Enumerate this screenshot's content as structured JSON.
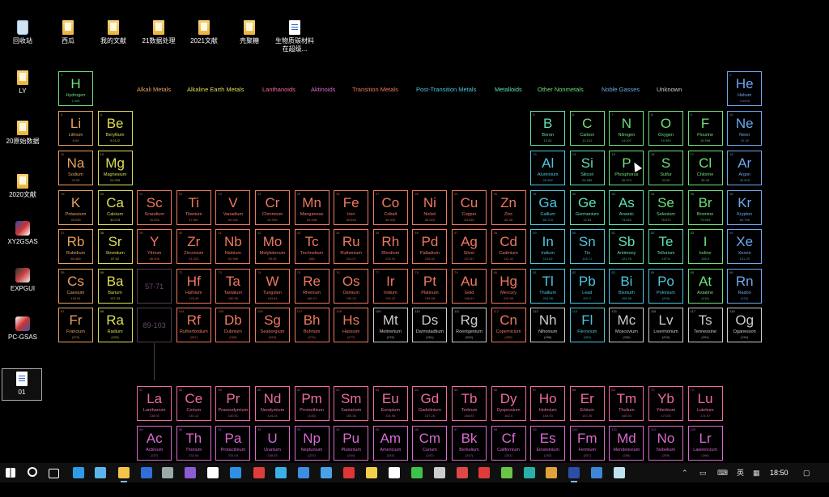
{
  "colors": {
    "alkali": "#e8a060",
    "alkaline": "#dedd5a",
    "transition": "#f07860",
    "post": "#4cc7e0",
    "metalloid": "#5ee0b0",
    "nonmetal": "#6ee07a",
    "noble": "#6ea8f0",
    "unknown": "#cccccc",
    "lanthanide": "#ee6aa6",
    "actinide": "#d86ad0"
  },
  "desktop_icons": [
    {
      "label": "回收站",
      "kind": "bin"
    },
    {
      "label": "LY",
      "kind": "folder"
    },
    {
      "label": "20原始数据",
      "kind": "folder"
    },
    {
      "label": "2020文献",
      "kind": "folder"
    },
    {
      "label": "XY2GSAS",
      "kind": "gsas"
    },
    {
      "label": "EXPGUI",
      "kind": "expgui"
    },
    {
      "label": "PC-GSAS",
      "kind": "pcgsas"
    },
    {
      "label": "01",
      "kind": "doc"
    },
    {
      "label": "西瓜",
      "kind": "folder"
    },
    {
      "label": "我的文献",
      "kind": "folder"
    },
    {
      "label": "21数据处理",
      "kind": "folder"
    },
    {
      "label": "2021文献",
      "kind": "folder"
    },
    {
      "label": "壳聚糖",
      "kind": "folder"
    },
    {
      "label": "生物质碳材料在超级...",
      "kind": "doc"
    }
  ],
  "legend": [
    {
      "label": "Alkali Metals",
      "cat": "alkali"
    },
    {
      "label": "Alkaline Earth Metals",
      "cat": "alkaline"
    },
    {
      "label": "Lanthanoids",
      "cat": "lanthanide"
    },
    {
      "label": "Aktinoids",
      "cat": "actinide"
    },
    {
      "label": "Transition Metals",
      "cat": "transition"
    },
    {
      "label": "Post-Transition Metals",
      "cat": "post"
    },
    {
      "label": "Metalloids",
      "cat": "metalloid"
    },
    {
      "label": "Other Nonmetals",
      "cat": "nonmetal"
    },
    {
      "label": "Noble Gasses",
      "cat": "noble"
    },
    {
      "label": "Unknown",
      "cat": "unknown"
    }
  ],
  "placeholders": [
    "57-71",
    "89-103"
  ],
  "elements": [
    {
      "n": 1,
      "s": "H",
      "name": "Hydrogen",
      "m": "1.008",
      "c": "nonmetal"
    },
    {
      "n": 2,
      "s": "He",
      "name": "Helium",
      "m": "4.0026",
      "c": "noble"
    },
    {
      "n": 3,
      "s": "Li",
      "name": "Lithium",
      "m": "6.94",
      "c": "alkali"
    },
    {
      "n": 4,
      "s": "Be",
      "name": "Beryllium",
      "m": "9.0122",
      "c": "alkaline"
    },
    {
      "n": 5,
      "s": "B",
      "name": "Boron",
      "m": "10.81",
      "c": "metalloid"
    },
    {
      "n": 6,
      "s": "C",
      "name": "Carbon",
      "m": "12.011",
      "c": "nonmetal"
    },
    {
      "n": 7,
      "s": "N",
      "name": "Nitrogen",
      "m": "14.007",
      "c": "nonmetal"
    },
    {
      "n": 8,
      "s": "O",
      "name": "Oxygen",
      "m": "15.999",
      "c": "nonmetal"
    },
    {
      "n": 9,
      "s": "F",
      "name": "Flourine",
      "m": "18.998",
      "c": "nonmetal"
    },
    {
      "n": 10,
      "s": "Ne",
      "name": "Neon",
      "m": "20.18",
      "c": "noble"
    },
    {
      "n": 11,
      "s": "Na",
      "name": "Sodium",
      "m": "22.99",
      "c": "alkali"
    },
    {
      "n": 12,
      "s": "Mg",
      "name": "Magnesium",
      "m": "24.305",
      "c": "alkaline"
    },
    {
      "n": 13,
      "s": "Al",
      "name": "Aluminium",
      "m": "26.982",
      "c": "post"
    },
    {
      "n": 14,
      "s": "Si",
      "name": "Silicon",
      "m": "28.085",
      "c": "metalloid"
    },
    {
      "n": 15,
      "s": "P",
      "name": "Phosphorus",
      "m": "30.974",
      "c": "nonmetal"
    },
    {
      "n": 16,
      "s": "S",
      "name": "Sulfur",
      "m": "32.06",
      "c": "nonmetal"
    },
    {
      "n": 17,
      "s": "Cl",
      "name": "Chlorine",
      "m": "35.45",
      "c": "nonmetal"
    },
    {
      "n": 18,
      "s": "Ar",
      "name": "Argon",
      "m": "39.948",
      "c": "noble"
    },
    {
      "n": 19,
      "s": "K",
      "name": "Potassium",
      "m": "39.098",
      "c": "alkali"
    },
    {
      "n": 20,
      "s": "Ca",
      "name": "Calcium",
      "m": "40.078",
      "c": "alkaline"
    },
    {
      "n": 21,
      "s": "Sc",
      "name": "Scandium",
      "m": "44.956",
      "c": "transition"
    },
    {
      "n": 22,
      "s": "Ti",
      "name": "Titanium",
      "m": "47.867",
      "c": "transition"
    },
    {
      "n": 23,
      "s": "V",
      "name": "Vanadium",
      "m": "50.942",
      "c": "transition"
    },
    {
      "n": 24,
      "s": "Cr",
      "name": "Chromium",
      "m": "51.996",
      "c": "transition"
    },
    {
      "n": 25,
      "s": "Mn",
      "name": "Manganese",
      "m": "54.938",
      "c": "transition"
    },
    {
      "n": 26,
      "s": "Fe",
      "name": "Iron",
      "m": "55.845",
      "c": "transition"
    },
    {
      "n": 27,
      "s": "Co",
      "name": "Cobalt",
      "m": "58.933",
      "c": "transition"
    },
    {
      "n": 28,
      "s": "Ni",
      "name": "Nickel",
      "m": "58.693",
      "c": "transition"
    },
    {
      "n": 29,
      "s": "Cu",
      "name": "Copper",
      "m": "63.546",
      "c": "transition"
    },
    {
      "n": 30,
      "s": "Zn",
      "name": "Zinc",
      "m": "65.38",
      "c": "transition"
    },
    {
      "n": 31,
      "s": "Ga",
      "name": "Gallium",
      "m": "69.723",
      "c": "post"
    },
    {
      "n": 32,
      "s": "Ge",
      "name": "Germanium",
      "m": "72.63",
      "c": "metalloid"
    },
    {
      "n": 33,
      "s": "As",
      "name": "Arsenic",
      "m": "74.922",
      "c": "metalloid"
    },
    {
      "n": 34,
      "s": "Se",
      "name": "Selenium",
      "m": "78.971",
      "c": "nonmetal"
    },
    {
      "n": 35,
      "s": "Br",
      "name": "Bromine",
      "m": "79.904",
      "c": "nonmetal"
    },
    {
      "n": 36,
      "s": "Kr",
      "name": "Krypton",
      "m": "83.798",
      "c": "noble"
    },
    {
      "n": 37,
      "s": "Rb",
      "name": "Rubidium",
      "m": "85.468",
      "c": "alkali"
    },
    {
      "n": 38,
      "s": "Sr",
      "name": "Strontium",
      "m": "87.62",
      "c": "alkaline"
    },
    {
      "n": 39,
      "s": "Y",
      "name": "Yttrium",
      "m": "88.906",
      "c": "transition"
    },
    {
      "n": 40,
      "s": "Zr",
      "name": "Zirconium",
      "m": "91.224",
      "c": "transition"
    },
    {
      "n": 41,
      "s": "Nb",
      "name": "Niobium",
      "m": "92.906",
      "c": "transition"
    },
    {
      "n": 42,
      "s": "Mo",
      "name": "Molybdenum",
      "m": "95.95",
      "c": "transition"
    },
    {
      "n": 43,
      "s": "Tc",
      "name": "Technetium",
      "m": "(98)",
      "c": "transition"
    },
    {
      "n": 44,
      "s": "Ru",
      "name": "Ruthenium",
      "m": "101.07",
      "c": "transition"
    },
    {
      "n": 45,
      "s": "Rh",
      "name": "Rhodium",
      "m": "102.91",
      "c": "transition"
    },
    {
      "n": 46,
      "s": "Pd",
      "name": "Palladium",
      "m": "106.42",
      "c": "transition"
    },
    {
      "n": 47,
      "s": "Ag",
      "name": "Silver",
      "m": "107.87",
      "c": "transition"
    },
    {
      "n": 48,
      "s": "Cd",
      "name": "Cadmium",
      "m": "112.41",
      "c": "transition"
    },
    {
      "n": 49,
      "s": "In",
      "name": "Indium",
      "m": "114.82",
      "c": "post"
    },
    {
      "n": 50,
      "s": "Sn",
      "name": "Tin",
      "m": "118.71",
      "c": "post"
    },
    {
      "n": 51,
      "s": "Sb",
      "name": "Antimony",
      "m": "121.76",
      "c": "metalloid"
    },
    {
      "n": 52,
      "s": "Te",
      "name": "Tellurium",
      "m": "127.6",
      "c": "metalloid"
    },
    {
      "n": 53,
      "s": "I",
      "name": "Iodine",
      "m": "126.9",
      "c": "nonmetal"
    },
    {
      "n": 54,
      "s": "Xe",
      "name": "Xenon",
      "m": "131.29",
      "c": "noble"
    },
    {
      "n": 55,
      "s": "Cs",
      "name": "Caesium",
      "m": "132.91",
      "c": "alkali"
    },
    {
      "n": 56,
      "s": "Ba",
      "name": "Barium",
      "m": "137.33",
      "c": "alkaline"
    },
    {
      "n": 72,
      "s": "Hf",
      "name": "Hafnium",
      "m": "178.49",
      "c": "transition"
    },
    {
      "n": 73,
      "s": "Ta",
      "name": "Tantalum",
      "m": "180.95",
      "c": "transition"
    },
    {
      "n": 74,
      "s": "W",
      "name": "Tungsten",
      "m": "183.84",
      "c": "transition"
    },
    {
      "n": 75,
      "s": "Re",
      "name": "Rhenium",
      "m": "186.21",
      "c": "transition"
    },
    {
      "n": 76,
      "s": "Os",
      "name": "Osmium",
      "m": "190.23",
      "c": "transition"
    },
    {
      "n": 77,
      "s": "Ir",
      "name": "Iridium",
      "m": "192.22",
      "c": "transition"
    },
    {
      "n": 78,
      "s": "Pt",
      "name": "Platinum",
      "m": "195.08",
      "c": "transition"
    },
    {
      "n": 79,
      "s": "Au",
      "name": "Gold",
      "m": "196.97",
      "c": "transition"
    },
    {
      "n": 80,
      "s": "Hg",
      "name": "Mercury",
      "m": "200.59",
      "c": "transition"
    },
    {
      "n": 81,
      "s": "Tl",
      "name": "Thallium",
      "m": "204.38",
      "c": "post"
    },
    {
      "n": 82,
      "s": "Pb",
      "name": "Lead",
      "m": "207.2",
      "c": "post"
    },
    {
      "n": 83,
      "s": "Bi",
      "name": "Bismuth",
      "m": "208.98",
      "c": "post"
    },
    {
      "n": 84,
      "s": "Po",
      "name": "Polonium",
      "m": "(209)",
      "c": "post"
    },
    {
      "n": 85,
      "s": "At",
      "name": "Astatine",
      "m": "(210)",
      "c": "nonmetal"
    },
    {
      "n": 86,
      "s": "Rn",
      "name": "Radon",
      "m": "(222)",
      "c": "noble"
    },
    {
      "n": 87,
      "s": "Fr",
      "name": "Francium",
      "m": "(223)",
      "c": "alkali"
    },
    {
      "n": 88,
      "s": "Ra",
      "name": "Radium",
      "m": "(226)",
      "c": "alkaline"
    },
    {
      "n": 104,
      "s": "Rf",
      "name": "Rutherfordium",
      "m": "(267)",
      "c": "transition"
    },
    {
      "n": 105,
      "s": "Db",
      "name": "Dubnium",
      "m": "(268)",
      "c": "transition"
    },
    {
      "n": 106,
      "s": "Sg",
      "name": "Seaborgium",
      "m": "(269)",
      "c": "transition"
    },
    {
      "n": 107,
      "s": "Bh",
      "name": "Bohrium",
      "m": "(270)",
      "c": "transition"
    },
    {
      "n": 108,
      "s": "Hs",
      "name": "Hassium",
      "m": "(277)",
      "c": "transition"
    },
    {
      "n": 109,
      "s": "Mt",
      "name": "Meitnerium",
      "m": "(278)",
      "c": "unknown"
    },
    {
      "n": 110,
      "s": "Ds",
      "name": "Darmstadtium",
      "m": "(281)",
      "c": "unknown"
    },
    {
      "n": 111,
      "s": "Rg",
      "name": "Roentgenium",
      "m": "(282)",
      "c": "unknown"
    },
    {
      "n": 112,
      "s": "Cn",
      "name": "Copernicium",
      "m": "(285)",
      "c": "transition"
    },
    {
      "n": 113,
      "s": "Nh",
      "name": "Nihonium",
      "m": "(286)",
      "c": "unknown"
    },
    {
      "n": 114,
      "s": "Fl",
      "name": "Flerovium",
      "m": "(289)",
      "c": "post"
    },
    {
      "n": 115,
      "s": "Mc",
      "name": "Moscovium",
      "m": "(290)",
      "c": "unknown"
    },
    {
      "n": 116,
      "s": "Lv",
      "name": "Livermorium",
      "m": "(293)",
      "c": "unknown"
    },
    {
      "n": 117,
      "s": "Ts",
      "name": "Tennessine",
      "m": "(294)",
      "c": "unknown"
    },
    {
      "n": 118,
      "s": "Og",
      "name": "Oganesson",
      "m": "(294)",
      "c": "unknown"
    },
    {
      "n": 57,
      "s": "La",
      "name": "Lanthanum",
      "m": "138.91",
      "c": "lanthanide"
    },
    {
      "n": 58,
      "s": "Ce",
      "name": "Cerium",
      "m": "140.12",
      "c": "lanthanide"
    },
    {
      "n": 59,
      "s": "Pr",
      "name": "Praseodymium",
      "m": "140.91",
      "c": "lanthanide"
    },
    {
      "n": 60,
      "s": "Nd",
      "name": "Neodymium",
      "m": "144.24",
      "c": "lanthanide"
    },
    {
      "n": 61,
      "s": "Pm",
      "name": "Promethium",
      "m": "(145)",
      "c": "lanthanide"
    },
    {
      "n": 62,
      "s": "Sm",
      "name": "Samarium",
      "m": "150.36",
      "c": "lanthanide"
    },
    {
      "n": 63,
      "s": "Eu",
      "name": "Europium",
      "m": "151.96",
      "c": "lanthanide"
    },
    {
      "n": 64,
      "s": "Gd",
      "name": "Gadolinium",
      "m": "157.25",
      "c": "lanthanide"
    },
    {
      "n": 65,
      "s": "Tb",
      "name": "Terbium",
      "m": "158.93",
      "c": "lanthanide"
    },
    {
      "n": 66,
      "s": "Dy",
      "name": "Dysprosium",
      "m": "162.5",
      "c": "lanthanide"
    },
    {
      "n": 67,
      "s": "Ho",
      "name": "Holmium",
      "m": "164.93",
      "c": "lanthanide"
    },
    {
      "n": 68,
      "s": "Er",
      "name": "Erbium",
      "m": "167.26",
      "c": "lanthanide"
    },
    {
      "n": 69,
      "s": "Tm",
      "name": "Thulium",
      "m": "168.93",
      "c": "lanthanide"
    },
    {
      "n": 70,
      "s": "Yb",
      "name": "Ytterbium",
      "m": "173.05",
      "c": "lanthanide"
    },
    {
      "n": 71,
      "s": "Lu",
      "name": "Lutetium",
      "m": "174.97",
      "c": "lanthanide"
    },
    {
      "n": 89,
      "s": "Ac",
      "name": "Actinium",
      "m": "(227)",
      "c": "actinide"
    },
    {
      "n": 90,
      "s": "Th",
      "name": "Thorium",
      "m": "232.04",
      "c": "actinide"
    },
    {
      "n": 91,
      "s": "Pa",
      "name": "Protactinium",
      "m": "231.04",
      "c": "actinide"
    },
    {
      "n": 92,
      "s": "U",
      "name": "Uranium",
      "m": "238.03",
      "c": "actinide"
    },
    {
      "n": 93,
      "s": "Np",
      "name": "Neptunium",
      "m": "(237)",
      "c": "actinide"
    },
    {
      "n": 94,
      "s": "Pu",
      "name": "Plutonium",
      "m": "(244)",
      "c": "actinide"
    },
    {
      "n": 95,
      "s": "Am",
      "name": "Americium",
      "m": "(243)",
      "c": "actinide"
    },
    {
      "n": 96,
      "s": "Cm",
      "name": "Curium",
      "m": "(247)",
      "c": "actinide"
    },
    {
      "n": 97,
      "s": "Bk",
      "name": "Berkelium",
      "m": "(247)",
      "c": "actinide"
    },
    {
      "n": 98,
      "s": "Cf",
      "name": "Californium",
      "m": "(251)",
      "c": "actinide"
    },
    {
      "n": 99,
      "s": "Es",
      "name": "Einsteinium",
      "m": "(252)",
      "c": "actinide"
    },
    {
      "n": 100,
      "s": "Fm",
      "name": "Fermium",
      "m": "(257)",
      "c": "actinide"
    },
    {
      "n": 101,
      "s": "Md",
      "name": "Mendelevium",
      "m": "(258)",
      "c": "actinide"
    },
    {
      "n": 102,
      "s": "No",
      "name": "Nobelium",
      "m": "(259)",
      "c": "actinide"
    },
    {
      "n": 103,
      "s": "Lr",
      "name": "Lawrencium",
      "m": "(266)",
      "c": "actinide"
    }
  ],
  "taskbar": {
    "clock": "18:50",
    "ime": "英",
    "apps": [
      {
        "icon": "start-icon",
        "color": "#ffffff"
      },
      {
        "icon": "search-icon",
        "color": "#ffffff"
      },
      {
        "icon": "task-view-icon",
        "color": "#ffffff"
      },
      {
        "icon": "edge-icon",
        "color": "#2f9be6"
      },
      {
        "icon": "computer-icon",
        "color": "#5bb5ea"
      },
      {
        "icon": "file-explorer-icon",
        "color": "#f3c34a"
      },
      {
        "icon": "cortana-icon",
        "color": "#2f6fd6"
      },
      {
        "icon": "calculator-icon",
        "color": "#9aa"
      },
      {
        "icon": "paint-icon",
        "color": "#8c5bd6"
      },
      {
        "icon": "notepad-icon",
        "color": "#ffffff"
      },
      {
        "icon": "qq-browser-icon",
        "color": "#2e8fe6"
      },
      {
        "icon": "wps-icon",
        "color": "#e03c3c"
      },
      {
        "icon": "tv-icon",
        "color": "#3ab0e6"
      },
      {
        "icon": "monitor-icon",
        "color": "#3d8de0"
      },
      {
        "icon": "origin-icon",
        "color": "#4aa1e6"
      },
      {
        "icon": "netease-music-icon",
        "color": "#e03535"
      },
      {
        "icon": "sticky-notes-icon",
        "color": "#f3cf4a"
      },
      {
        "icon": "qq-icon",
        "color": "#ffffff"
      },
      {
        "icon": "wechat-icon",
        "color": "#3fc24a"
      },
      {
        "icon": "printer-icon",
        "color": "#cccccc"
      },
      {
        "icon": "outlook-icon",
        "color": "#e04848"
      },
      {
        "icon": "toolbox-icon",
        "color": "#e03b3b"
      },
      {
        "icon": "terminal-icon",
        "color": "#6ac44a"
      },
      {
        "icon": "network-icon",
        "color": "#2ab0a8"
      },
      {
        "icon": "chrome-icon",
        "color": "#e0a23a"
      },
      {
        "icon": "photoshop-icon",
        "color": "#2b4fa6"
      },
      {
        "icon": "dev-icon",
        "color": "#3e86d6"
      },
      {
        "icon": "diamond-icon",
        "color": "#bfe2f0"
      }
    ]
  }
}
